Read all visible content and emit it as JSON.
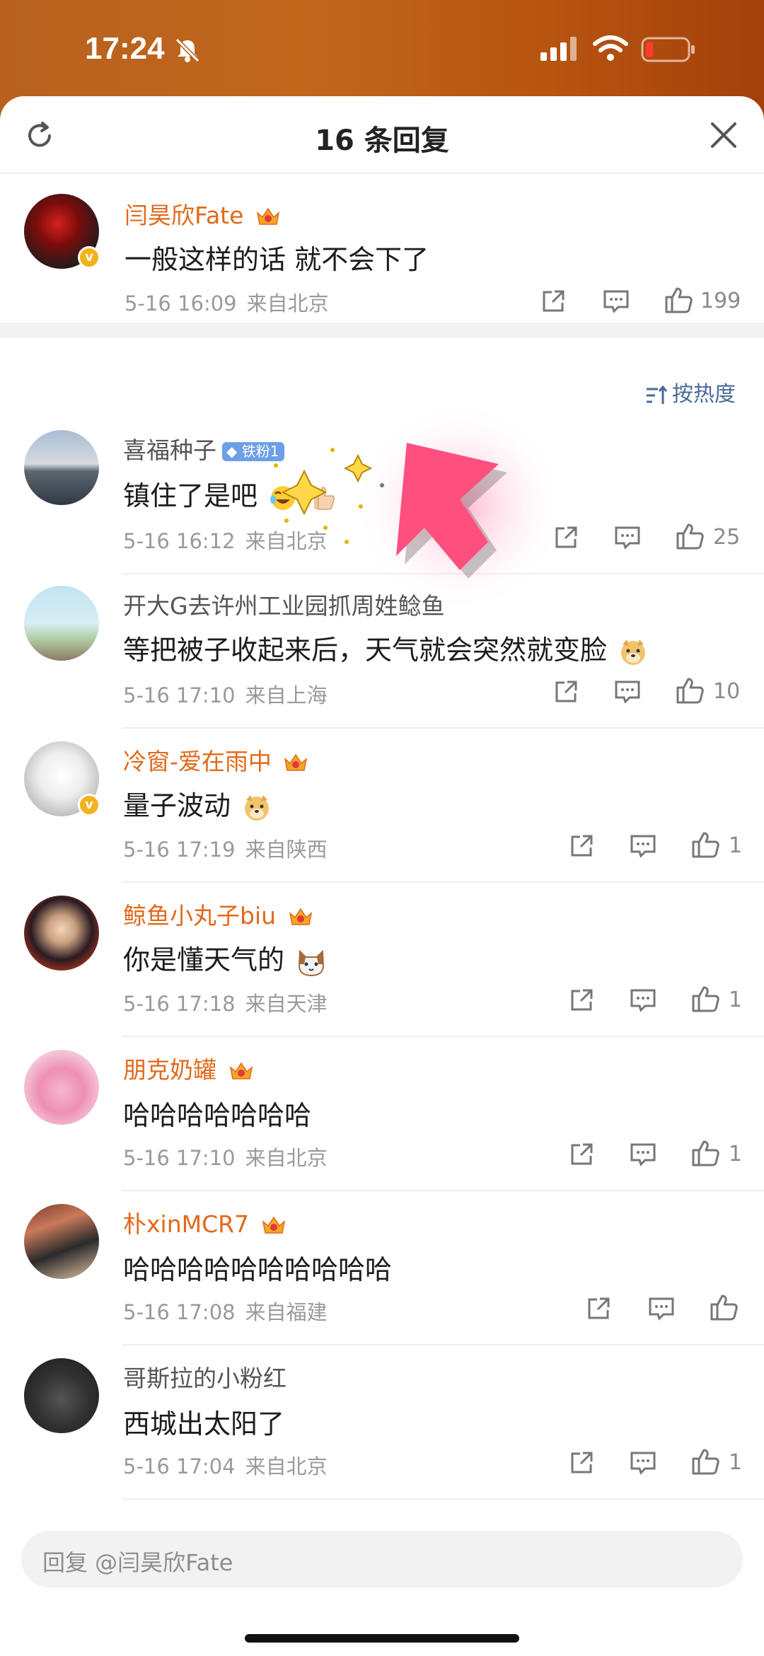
{
  "status_bar": {
    "time": "17:24"
  },
  "header": {
    "title": "16 条回复"
  },
  "top_comment": {
    "username": "闫昊欣Fate",
    "text": "一般这样的话 就不会下了",
    "date": "5-16 16:09",
    "location": "来自北京",
    "likes": "199"
  },
  "sort": {
    "label": "按热度"
  },
  "replies": [
    {
      "username": "喜福种子",
      "badge": "铁粉1",
      "text": "镇住了是吧",
      "date": "5-16 16:12",
      "location": "来自北京",
      "likes": "25"
    },
    {
      "username": "开大G去许州工业园抓周姓鲶鱼",
      "text": "等把被子收起来后，天气就会突然就变脸",
      "date": "5-16 17:10",
      "location": "来自上海",
      "likes": "10"
    },
    {
      "username": "冷窗-爱在雨中",
      "text": "量子波动",
      "date": "5-16 17:19",
      "location": "来自陕西",
      "likes": "1"
    },
    {
      "username": "鲸鱼小丸子biu",
      "text": "你是懂天气的",
      "date": "5-16 17:18",
      "location": "来自天津",
      "likes": "1"
    },
    {
      "username": "朋克奶罐",
      "text": "哈哈哈哈哈哈哈",
      "date": "5-16 17:10",
      "location": "来自北京",
      "likes": "1"
    },
    {
      "username": "朴xinMCR7",
      "text": "哈哈哈哈哈哈哈哈哈哈",
      "date": "5-16 17:08",
      "location": "来自福建",
      "likes": ""
    },
    {
      "username": "哥斯拉的小粉红",
      "text": "西城出太阳了",
      "date": "5-16 17:04",
      "location": "来自北京",
      "likes": "1"
    }
  ],
  "reply_bar": {
    "placeholder": "回复 @闫昊欣Fate"
  },
  "colors": {
    "vip_name": "#e2691a",
    "link_blue": "#496a9a",
    "status_bg": "#b8611f"
  }
}
